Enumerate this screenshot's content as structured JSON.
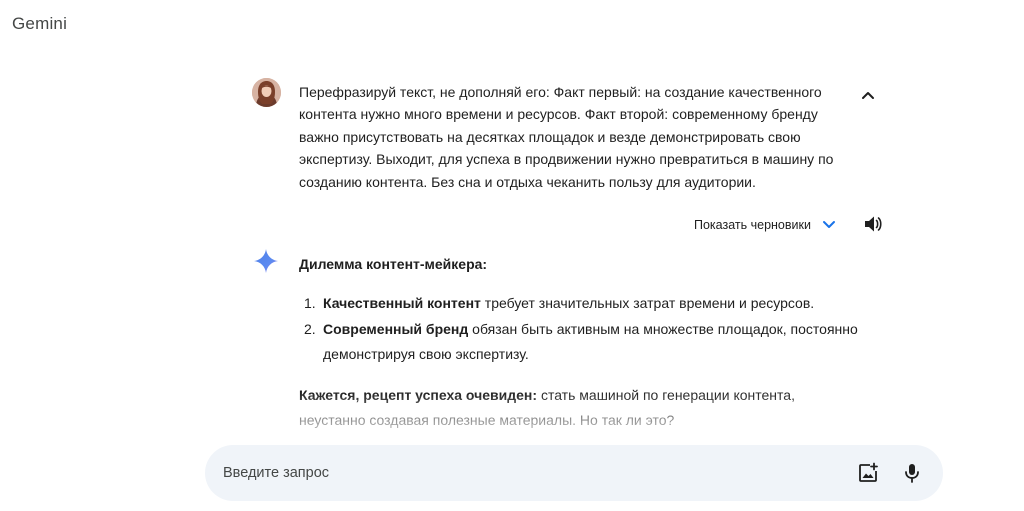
{
  "app": {
    "title": "Gemini"
  },
  "user_prompt": {
    "avatar": "user-avatar",
    "text": "Перефразируй текст, не дополняй его: Факт первый: на создание качественного контента нужно много времени и ресурсов. Факт второй: современному бренду важно присутствовать на десятках площадок и везде демонстрировать свою экспертизу. Выходит, для успеха в продвижении нужно превратиться в машину по созданию контента. Без сна и отдыха чеканить пользу для аудитории.",
    "collapse_icon": "chevron-up-icon"
  },
  "drafts": {
    "label": "Показать черновики",
    "chevron_icon": "chevron-down-icon",
    "speaker_icon": "speaker-icon"
  },
  "response": {
    "icon": "gemini-spark-icon",
    "heading": "Дилемма контент-мейкера:",
    "items": [
      {
        "num": "1.",
        "bold": "Качественный контент",
        "rest": " требует значительных затрат времени и ресурсов."
      },
      {
        "num": "2.",
        "bold": "Современный бренд",
        "rest": " обязан быть активным на множестве площадок, постоянно демонстрируя свою экспертизу."
      }
    ],
    "conclusion_bold": "Кажется, рецепт успеха очевиден:",
    "conclusion_rest": " стать машиной по генерации контента, неустанно создавая полезные материалы. Но так ли это?"
  },
  "input": {
    "placeholder": "Введите запрос",
    "value": "",
    "image_icon": "add-image-icon",
    "mic_icon": "microphone-icon"
  },
  "colors": {
    "accent_blue": "#1a73e8",
    "input_bg": "#f0f4f9",
    "text": "#1f1f1f",
    "muted": "#444746"
  }
}
